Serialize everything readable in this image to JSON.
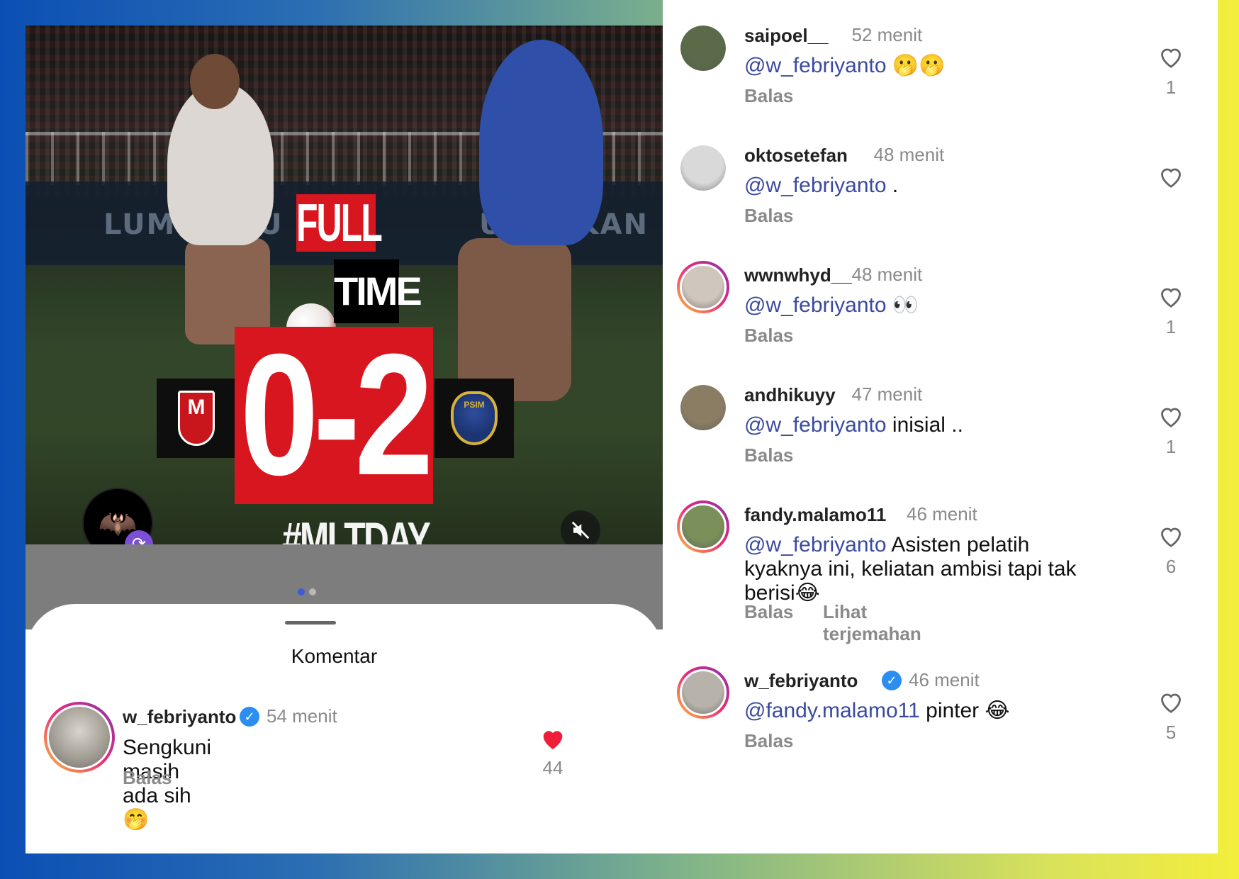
{
  "post": {
    "banner_left": "LUM MALU",
    "banner_right": "UNG IKAN KU",
    "full_label": "FULL",
    "time_label": "TIME",
    "score": "0-2",
    "hashtag": "#MLTDAY",
    "left_team_logo_text": "M",
    "right_team_logo_text": "PSIM",
    "account_logo_glyph": "🦇",
    "repost_glyph": "⟳",
    "mute_icon": "speaker-muted-icon",
    "carousel": {
      "count": 2,
      "active_index": 0
    }
  },
  "sheet": {
    "title": "Komentar"
  },
  "main_comment": {
    "username": "w_febriyanto",
    "verified": true,
    "time": "54 menit",
    "text": "Sengkuni masih ada sih",
    "emoji": "🤭",
    "reply_label": "Balas",
    "likes": "44",
    "liked": true
  },
  "comments": [
    {
      "username": "saipoel__",
      "time": "52 menit",
      "mention": "@w_febriyanto",
      "rest": " 🫢🫢",
      "reply_label": "Balas",
      "likes": "1",
      "avatar_color": "#5b6a48",
      "ring": false
    },
    {
      "username": "oktosetefan",
      "time": "48 menit",
      "mention": "@w_febriyanto",
      "rest": " .",
      "reply_label": "Balas",
      "likes": "",
      "avatar_color": "#d9d9d9",
      "ring": false
    },
    {
      "username": "wwnwhyd__",
      "time": "48 menit",
      "mention": "@w_febriyanto",
      "rest": " 👀",
      "reply_label": "Balas",
      "likes": "1",
      "avatar_color": "#cfc7bd",
      "ring": true
    },
    {
      "username": "andhikuyy",
      "time": "47 menit",
      "mention": "@w_febriyanto",
      "rest": " inisial ..",
      "reply_label": "Balas",
      "likes": "1",
      "avatar_color": "#8a7d63",
      "ring": false
    },
    {
      "username": "fandy.malamo11",
      "time": "46 menit",
      "mention": "@w_febriyanto",
      "rest": " Asisten pelatih kyaknya ini, keliatan ambisi tapi tak berisi😂",
      "reply_label": "Balas",
      "translate_label": "Lihat terjemahan",
      "likes": "6",
      "avatar_color": "#7a8f5a",
      "ring": true
    },
    {
      "username": "w_febriyanto",
      "verified": true,
      "time": "46 menit",
      "mention": "@fandy.malamo11",
      "rest": " pinter 😂",
      "reply_label": "Balas",
      "likes": "5",
      "avatar_color": "#b7b3ab",
      "ring": true
    }
  ],
  "colors": {
    "mention": "#3a4aa0",
    "heart_liked": "#ee1d3a",
    "score_red": "#d8161f",
    "verified_blue": "#2c8ef0"
  }
}
